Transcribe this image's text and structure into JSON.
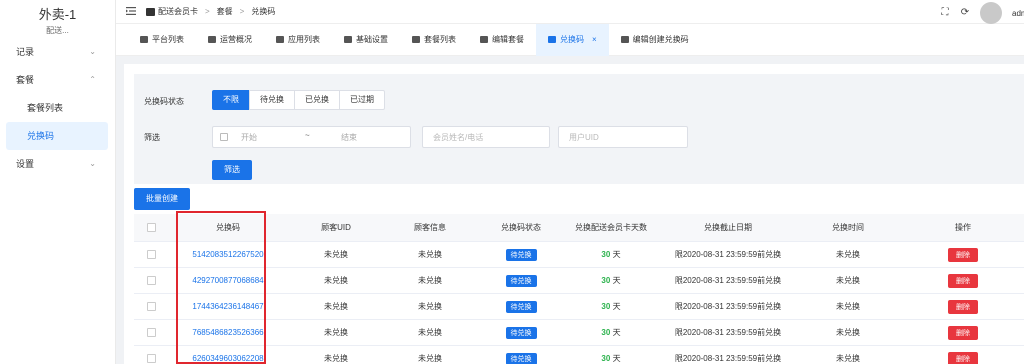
{
  "sidebar": {
    "brand_title": "外卖-1",
    "brand_sub": "配送...",
    "items": [
      {
        "label": "记录",
        "chevron": "⌄"
      },
      {
        "label": "套餐",
        "chevron": "⌃"
      },
      {
        "label": "套餐列表"
      },
      {
        "label": "兑换码"
      },
      {
        "label": "设置",
        "chevron": "⌄"
      }
    ]
  },
  "header": {
    "breadcrumb": [
      "配送会员卡",
      "套餐",
      "兑换码"
    ],
    "user_name": "adm"
  },
  "tabs": [
    {
      "label": "平台列表"
    },
    {
      "label": "运营概况"
    },
    {
      "label": "应用列表"
    },
    {
      "label": "基础设置"
    },
    {
      "label": "套餐列表"
    },
    {
      "label": "编辑套餐"
    },
    {
      "label": "兑换码",
      "close": "×"
    },
    {
      "label": "编辑创建兑换码"
    }
  ],
  "filter": {
    "status_label": "兑换码状态",
    "status_options": [
      "不限",
      "待兑换",
      "已兑换",
      "已过期"
    ],
    "status_selected": "不限",
    "filter_label": "筛选",
    "date_start": "开始",
    "date_to": "~",
    "date_end": "结束",
    "member_placeholder": "会员姓名/电话",
    "uid_placeholder": "用户UID",
    "filter_button": "筛选"
  },
  "batch_create_button": "批量创建",
  "table": {
    "columns": [
      "兑换码",
      "顾客UID",
      "顾客信息",
      "兑换码状态",
      "兑换配送会员卡天数",
      "兑换截止日期",
      "兑换时间",
      "操作"
    ],
    "rows": [
      {
        "code": "5142083512267520",
        "uid": "未兑换",
        "info": "未兑换",
        "status": "待兑换",
        "days": "30",
        "unit": "天",
        "deadline": "限2020-08-31 23:59:59前兑换",
        "time": "未兑换",
        "action": "删除"
      },
      {
        "code": "4292700877068684",
        "uid": "未兑换",
        "info": "未兑换",
        "status": "待兑换",
        "days": "30",
        "unit": "天",
        "deadline": "限2020-08-31 23:59:59前兑换",
        "time": "未兑换",
        "action": "删除"
      },
      {
        "code": "1744364236148467",
        "uid": "未兑换",
        "info": "未兑换",
        "status": "待兑换",
        "days": "30",
        "unit": "天",
        "deadline": "限2020-08-31 23:59:59前兑换",
        "time": "未兑换",
        "action": "删除"
      },
      {
        "code": "7685486823526366",
        "uid": "未兑换",
        "info": "未兑换",
        "status": "待兑换",
        "days": "30",
        "unit": "天",
        "deadline": "限2020-08-31 23:59:59前兑换",
        "time": "未兑换",
        "action": "删除"
      },
      {
        "code": "6260349603062208",
        "uid": "未兑换",
        "info": "未兑换",
        "status": "待兑换",
        "days": "30",
        "unit": "天",
        "deadline": "限2020-08-31 23:59:59前兑换",
        "time": "未兑换",
        "action": "删除"
      }
    ]
  },
  "colors": {
    "primary": "#1a73e8",
    "danger": "#e8363e",
    "success": "#2bb24c",
    "highlight": "#e0262e"
  }
}
